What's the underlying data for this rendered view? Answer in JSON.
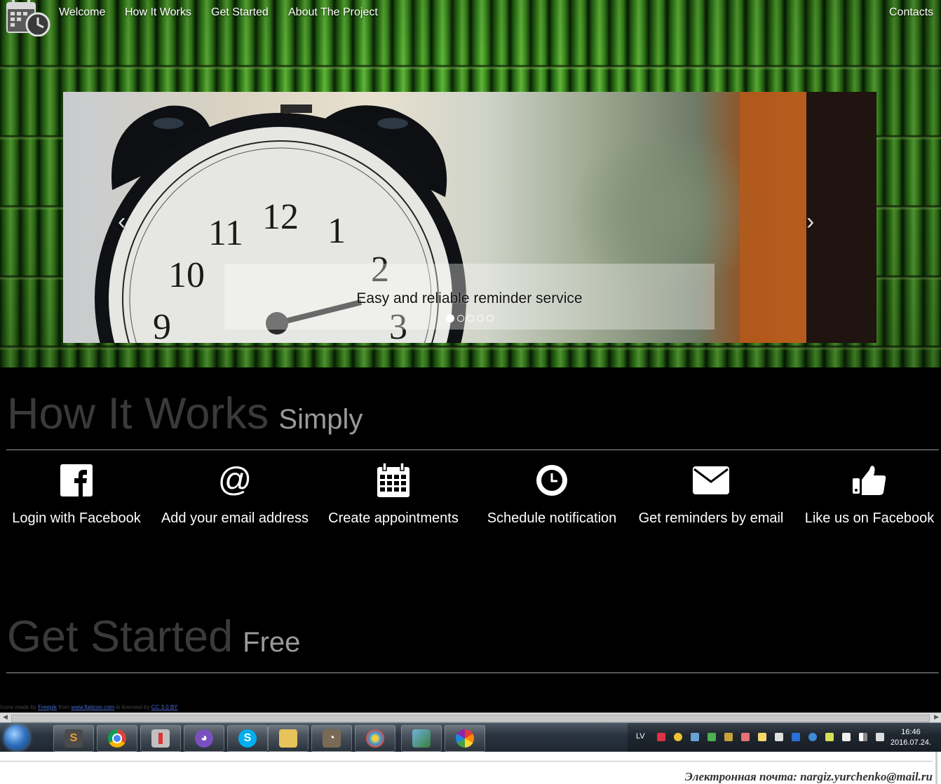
{
  "nav": {
    "items": [
      "Welcome",
      "How It Works",
      "Get Started",
      "About The Project"
    ],
    "contacts": "Contacts"
  },
  "carousel": {
    "caption": "Easy and reliable reminder service",
    "slide_count": 5,
    "active_index": 0,
    "prev_symbol": "‹",
    "next_symbol": "›"
  },
  "how_it_works": {
    "title": "How It Works",
    "subtitle": "Simply",
    "steps": [
      {
        "label": "Login with Facebook",
        "icon": "facebook-icon"
      },
      {
        "label": "Add your email address",
        "icon": "at-sign-icon"
      },
      {
        "label": "Create appointments",
        "icon": "calendar-icon"
      },
      {
        "label": "Schedule notification",
        "icon": "clock-icon"
      },
      {
        "label": "Get reminders by email",
        "icon": "envelope-icon"
      },
      {
        "label": "Like us on Facebook",
        "icon": "thumbs-up-icon"
      }
    ]
  },
  "get_started": {
    "title": "Get Started",
    "subtitle": "Free"
  },
  "credit": {
    "text1": "Icons made by",
    "author": "Freepik",
    "text2": "from",
    "site": "www.flaticon.com",
    "text3": "is licensed by",
    "license": "CC 3.0 BY"
  },
  "taskbar": {
    "apps": [
      "sublime-text",
      "chrome",
      "joystick",
      "github-desktop",
      "skype",
      "file-explorer",
      "gimp",
      "paint",
      "photo-viewer",
      "picasa"
    ],
    "language": "LV",
    "time": "16:46",
    "date": "2016.07.24."
  },
  "footer": {
    "email_line": "Электронная почта: nargiz.yurchenko@mail.ru"
  },
  "colors": {
    "background": "#000000",
    "title_gray": "#3a3a3a",
    "subtitle_gray": "#9a9a9a",
    "link_blue": "#4a6cd0"
  }
}
